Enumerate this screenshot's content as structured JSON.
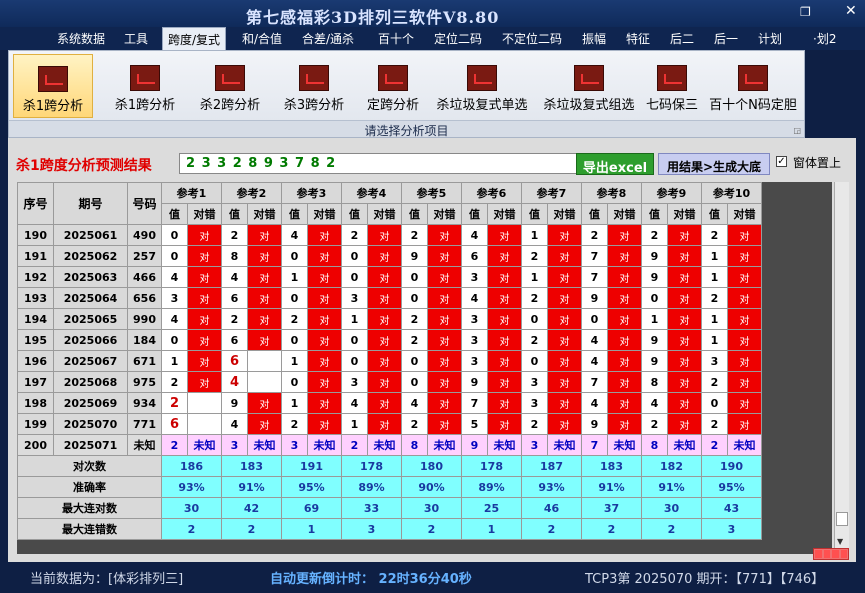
{
  "window": {
    "title": "第七感福彩3D排列三软件V8.80"
  },
  "menu": [
    "系统数据",
    "工具",
    "跨度/复式",
    "和/合值",
    "合差/通杀",
    "百十个",
    "定位二码",
    "不定位二码",
    "振幅",
    "特征",
    "后二",
    "后一",
    "计划",
    "·划2"
  ],
  "ribbon": {
    "buttons": [
      "杀1跨分析",
      "杀1跨分析",
      "杀2跨分析",
      "杀3跨分析",
      "定跨分析",
      "杀垃圾复式单选",
      "杀垃圾复式组选",
      "七码保三",
      "百十个N码定胆"
    ],
    "group_label": "请选择分析项目"
  },
  "result": {
    "label": "杀1跨度分析预测结果",
    "value": "2 3 3 2 8 9 3 7 8 2",
    "export_label": "导出excel",
    "generate_label": "用结果>生成大底",
    "pin_label": "窗体置上",
    "pin_checked": "✓"
  },
  "grid": {
    "col_seq": "序号",
    "col_period": "期号",
    "col_num": "号码",
    "refs": [
      "参考1",
      "参考2",
      "参考3",
      "参考4",
      "参考5",
      "参考6",
      "参考7",
      "参考8",
      "参考9",
      "参考10"
    ],
    "sub_val": "值",
    "sub_res": "对错",
    "rows": [
      {
        "seq": "190",
        "period": "2025061",
        "num": "490",
        "vals": [
          "0",
          "2",
          "4",
          "2",
          "2",
          "4",
          "1",
          "2",
          "2",
          "2"
        ],
        "res": [
          "对",
          "对",
          "对",
          "对",
          "对",
          "对",
          "对",
          "对",
          "对",
          "对"
        ]
      },
      {
        "seq": "191",
        "period": "2025062",
        "num": "257",
        "vals": [
          "0",
          "8",
          "0",
          "0",
          "9",
          "6",
          "2",
          "7",
          "9",
          "1"
        ],
        "res": [
          "对",
          "对",
          "对",
          "对",
          "对",
          "对",
          "对",
          "对",
          "对",
          "对"
        ]
      },
      {
        "seq": "192",
        "period": "2025063",
        "num": "466",
        "vals": [
          "4",
          "4",
          "1",
          "0",
          "0",
          "3",
          "1",
          "7",
          "9",
          "1"
        ],
        "res": [
          "对",
          "对",
          "对",
          "对",
          "对",
          "对",
          "对",
          "对",
          "对",
          "对"
        ]
      },
      {
        "seq": "193",
        "period": "2025064",
        "num": "656",
        "vals": [
          "3",
          "6",
          "0",
          "3",
          "0",
          "4",
          "2",
          "9",
          "0",
          "2"
        ],
        "res": [
          "对",
          "对",
          "对",
          "对",
          "对",
          "对",
          "对",
          "对",
          "对",
          "对"
        ]
      },
      {
        "seq": "194",
        "period": "2025065",
        "num": "990",
        "vals": [
          "4",
          "2",
          "2",
          "1",
          "2",
          "3",
          "0",
          "0",
          "1",
          "1"
        ],
        "res": [
          "对",
          "对",
          "对",
          "对",
          "对",
          "对",
          "对",
          "对",
          "对",
          "对"
        ]
      },
      {
        "seq": "195",
        "period": "2025066",
        "num": "184",
        "vals": [
          "0",
          "6",
          "0",
          "0",
          "2",
          "3",
          "2",
          "4",
          "9",
          "1"
        ],
        "res": [
          "对",
          "对",
          "对",
          "对",
          "对",
          "对",
          "对",
          "对",
          "对",
          "对"
        ]
      },
      {
        "seq": "196",
        "period": "2025067",
        "num": "671",
        "vals": [
          "1",
          "6",
          "1",
          "0",
          "0",
          "3",
          "0",
          "4",
          "9",
          "3"
        ],
        "res": [
          "对",
          "",
          "对",
          "对",
          "对",
          "对",
          "对",
          "对",
          "对",
          "对"
        ]
      },
      {
        "seq": "197",
        "period": "2025068",
        "num": "975",
        "vals": [
          "2",
          "4",
          "0",
          "3",
          "0",
          "9",
          "3",
          "7",
          "8",
          "2"
        ],
        "res": [
          "对",
          "",
          "对",
          "对",
          "对",
          "对",
          "对",
          "对",
          "对",
          "对"
        ]
      },
      {
        "seq": "198",
        "period": "2025069",
        "num": "934",
        "vals": [
          "2",
          "9",
          "1",
          "4",
          "4",
          "7",
          "3",
          "4",
          "4",
          "0"
        ],
        "res": [
          "",
          "对",
          "对",
          "对",
          "对",
          "对",
          "对",
          "对",
          "对",
          "对"
        ]
      },
      {
        "seq": "199",
        "period": "2025070",
        "num": "771",
        "vals": [
          "6",
          "4",
          "2",
          "1",
          "2",
          "5",
          "2",
          "9",
          "2",
          "2"
        ],
        "res": [
          "",
          "对",
          "对",
          "对",
          "对",
          "对",
          "对",
          "对",
          "对",
          "对"
        ]
      }
    ],
    "pending": {
      "seq": "200",
      "period": "2025071",
      "num": "未知",
      "vals": [
        "2",
        "3",
        "3",
        "2",
        "8",
        "9",
        "3",
        "7",
        "8",
        "2"
      ],
      "res": "未知"
    },
    "stats": [
      {
        "label": "对次数",
        "values": [
          "186",
          "183",
          "191",
          "178",
          "180",
          "178",
          "187",
          "183",
          "182",
          "190"
        ]
      },
      {
        "label": "准确率",
        "values": [
          "93%",
          "91%",
          "95%",
          "89%",
          "90%",
          "89%",
          "93%",
          "91%",
          "91%",
          "95%"
        ]
      },
      {
        "label": "最大连对数",
        "values": [
          "30",
          "42",
          "69",
          "33",
          "30",
          "25",
          "46",
          "37",
          "30",
          "43"
        ]
      },
      {
        "label": "最大连错数",
        "values": [
          "2",
          "2",
          "1",
          "3",
          "2",
          "1",
          "2",
          "2",
          "2",
          "3"
        ]
      }
    ]
  },
  "status": {
    "current": "当前数据为：[体彩排列三]",
    "countdown": "自动更新倒计时： 22时36分40秒",
    "draw": "TCP3第 2025070 期开：【771】【746】"
  }
}
